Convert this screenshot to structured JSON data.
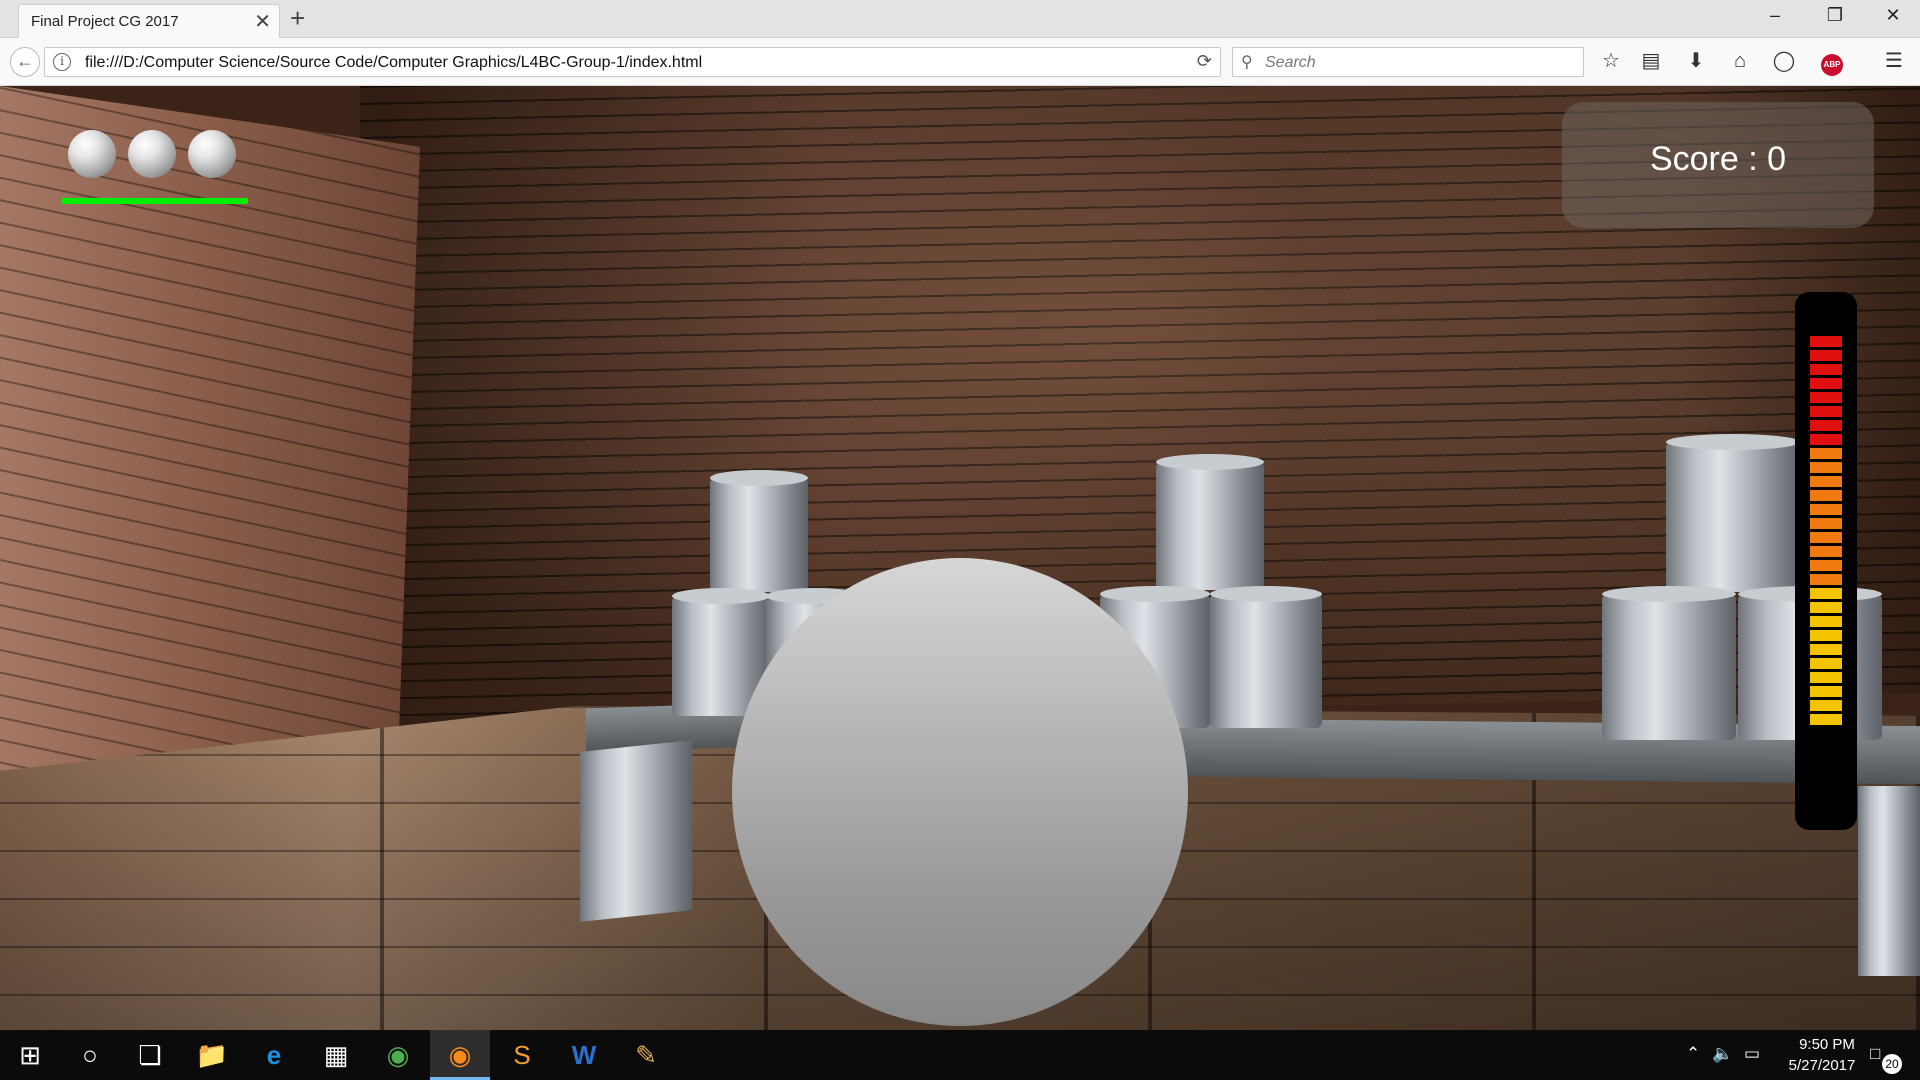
{
  "browser": {
    "tab_title": "Final Project CG 2017",
    "tab_close": "✕",
    "new_tab": "+",
    "url": "file:///D:/Computer Science/Source Code/Computer Graphics/L4BC-Group-1/index.html",
    "search_placeholder": "Search",
    "abp_label": "ABP"
  },
  "game": {
    "lives_remaining": 3,
    "health_fraction": 1.0,
    "score_text": "Score : 0",
    "power_meter": {
      "segments_total": 28,
      "segments_red": 8,
      "segments_orange": 10,
      "segments_yellow": 10,
      "colors": {
        "red": "#e01010",
        "orange": "#f07a10",
        "yellow": "#f5c400"
      }
    },
    "health_color": "#00ee00"
  },
  "taskbar": {
    "time": "9:50 PM",
    "date": "5/27/2017",
    "notification_count": "20",
    "pinned": [
      "start-icon",
      "cortana-icon",
      "task-view-icon",
      "file-explorer-icon",
      "edge-icon",
      "store-icon",
      "chrome-icon",
      "firefox-icon",
      "sublime-icon",
      "word-icon",
      "paint-icon"
    ]
  }
}
